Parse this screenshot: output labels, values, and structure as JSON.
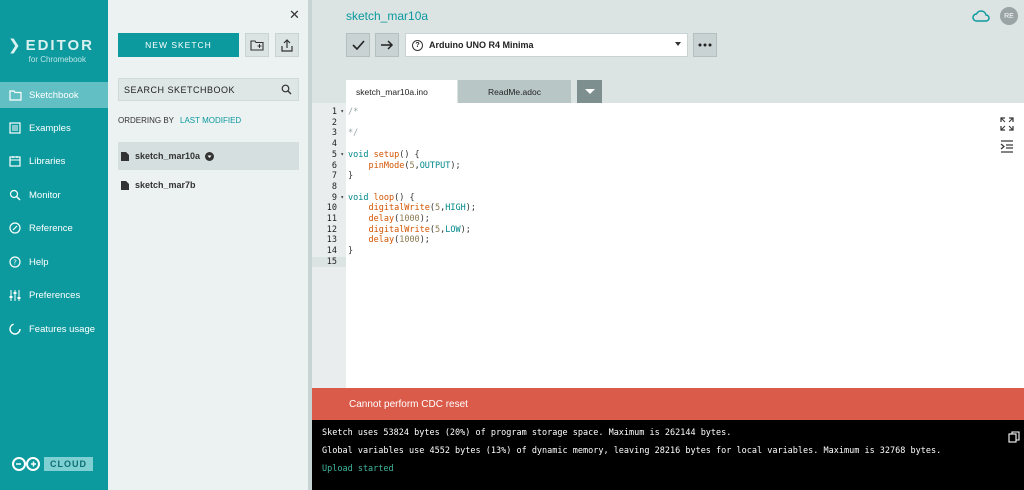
{
  "brand": {
    "name": "EDITOR",
    "sub": "for Chromebook",
    "cloud_badge": "CLOUD"
  },
  "nav": [
    {
      "label": "Sketchbook",
      "icon": "folder-icon",
      "active": true
    },
    {
      "label": "Examples",
      "icon": "examples-icon"
    },
    {
      "label": "Libraries",
      "icon": "libraries-icon"
    },
    {
      "label": "Monitor",
      "icon": "monitor-icon"
    },
    {
      "label": "Reference",
      "icon": "reference-icon"
    },
    {
      "label": "Help",
      "icon": "help-icon"
    },
    {
      "label": "Preferences",
      "icon": "preferences-icon"
    },
    {
      "label": "Features usage",
      "icon": "features-usage-icon"
    }
  ],
  "sketchbook": {
    "new_sketch_label": "NEW SKETCH",
    "search_placeholder": "SEARCH SKETCHBOOK",
    "ordering_label": "ORDERING BY",
    "ordering_value": "LAST MODIFIED",
    "files": [
      "sketch_mar10a",
      "sketch_mar7b"
    ]
  },
  "main": {
    "sketch_title": "sketch_mar10a",
    "user_initials": "RE",
    "board": "Arduino UNO R4 Minima",
    "tabs": [
      "sketch_mar10a.ino",
      "ReadMe.adoc"
    ]
  },
  "editor": {
    "line_numbers": [
      "1",
      "2",
      "3",
      "4",
      "5",
      "6",
      "7",
      "8",
      "9",
      "10",
      "11",
      "12",
      "13",
      "14",
      "15"
    ]
  },
  "status": {
    "error": "Cannot perform CDC reset"
  },
  "console": {
    "line1": "Sketch uses 53824 bytes (20%) of program storage space. Maximum is 262144 bytes.",
    "line2": "Global variables use 4552 bytes (13%) of dynamic memory, leaving 28216 bytes for local variables. Maximum is 32768 bytes.",
    "line3": "Upload started"
  },
  "colors": {
    "teal": "#0c9a9e",
    "error": "#da5b4a"
  }
}
